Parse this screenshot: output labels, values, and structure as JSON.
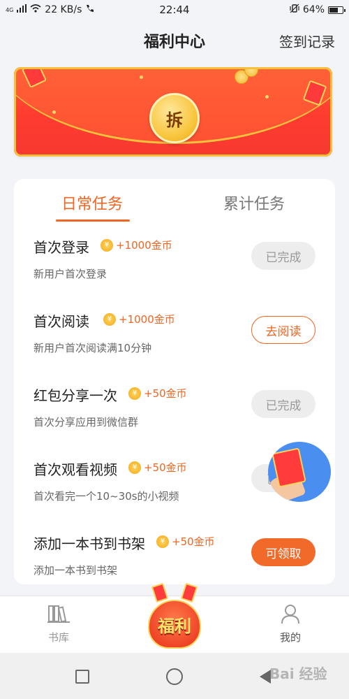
{
  "status_bar": {
    "network": "4G",
    "speed": "22 KB/s",
    "time": "22:44",
    "battery": "64%"
  },
  "header": {
    "title": "福利中心",
    "signin_record": "签到记录"
  },
  "banner": {
    "open_label": "拆"
  },
  "tabs": {
    "daily": "日常任务",
    "cumulative": "累计任务"
  },
  "tasks": [
    {
      "title": "首次登录",
      "reward": "+1000金币",
      "desc": "新用户首次登录",
      "button": "已完成",
      "state": "done"
    },
    {
      "title": "首次阅读",
      "reward": "+1000金币",
      "desc": "新用户首次阅读满10分钟",
      "button": "去阅读",
      "state": "go"
    },
    {
      "title": "红包分享一次",
      "reward": "+50金币",
      "desc": "首次分享应用到微信群",
      "button": "已完成",
      "state": "done"
    },
    {
      "title": "首次观看视频",
      "reward": "+50金币",
      "desc": "首次看完一个10~30s的小视频",
      "button": "已",
      "state": "done"
    },
    {
      "title": "添加一本书到书架",
      "reward": "+50金币",
      "desc": "添加一本书到书架",
      "button": "可领取",
      "state": "claim"
    }
  ],
  "coin_symbol": "¥",
  "bottom_tabs": {
    "library": "书库",
    "welfare": "福利",
    "mine": "我的"
  },
  "watermark": "Bai 经验",
  "colors": {
    "accent": "#f06522",
    "banner_red": "#ff3b30",
    "gold": "#f6c23e"
  }
}
